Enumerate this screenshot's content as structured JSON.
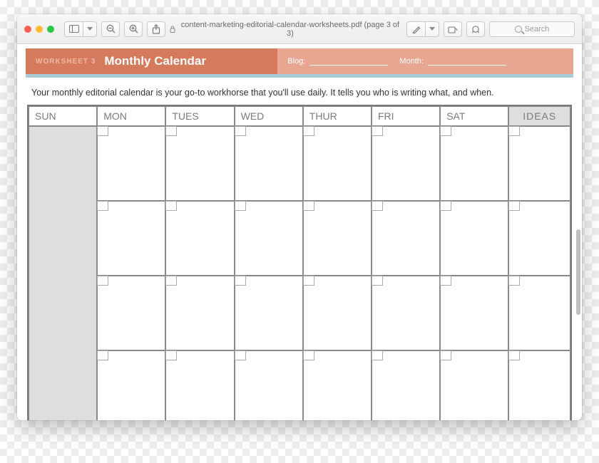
{
  "window": {
    "title": "content-marketing-editorial-calendar-worksheets.pdf (page 3 of 3)",
    "search_placeholder": "Search"
  },
  "doc": {
    "worksheet_label": "WORKSHEET 3",
    "title": "Monthly Calendar",
    "blog_label": "Blog:",
    "month_label": "Month:",
    "subtitle": "Your monthly editorial calendar is your go-to workhorse that you'll use daily. It tells you who is writing what, and when.",
    "days": [
      "SUN",
      "MON",
      "TUES",
      "WED",
      "THUR",
      "FRI",
      "SAT"
    ],
    "ideas_label": "IDEAS"
  }
}
